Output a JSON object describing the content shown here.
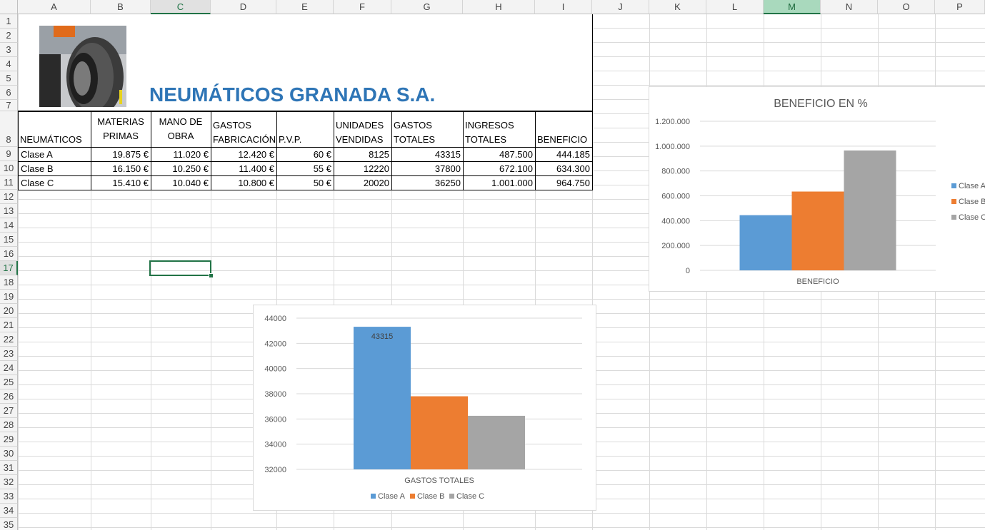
{
  "columns": [
    "A",
    "B",
    "C",
    "D",
    "E",
    "F",
    "G",
    "H",
    "I",
    "J",
    "K",
    "L",
    "M",
    "N",
    "O",
    "P"
  ],
  "rows": [
    "1",
    "2",
    "3",
    "4",
    "5",
    "6",
    "7",
    "8",
    "9",
    "10",
    "11",
    "12",
    "13",
    "14",
    "15",
    "16",
    "17",
    "18",
    "19",
    "20",
    "21",
    "22",
    "23",
    "24",
    "25",
    "26",
    "27",
    "28",
    "29",
    "30",
    "31",
    "32",
    "33",
    "34",
    "35"
  ],
  "title": "NEUMÁTICOS GRANADA S.A.",
  "table": {
    "headers": {
      "a": "NEUMÁTICOS",
      "b1": "MATERIAS",
      "b2": "PRIMAS",
      "c1": "MANO DE",
      "c2": "OBRA",
      "d1": "GASTOS",
      "d2": "FABRICACIÓN",
      "e": "P.V.P.",
      "f1": "UNIDADES",
      "f2": "VENDIDAS",
      "g1": "GASTOS",
      "g2": "TOTALES",
      "h1": "INGRESOS",
      "h2": "TOTALES",
      "i": "BENEFICIO"
    },
    "rows": [
      [
        "Clase A",
        "19.875 €",
        "11.020 €",
        "12.420 €",
        "60 €",
        "8125",
        "43315",
        "487.500",
        "444.185"
      ],
      [
        "Clase B",
        "16.150 €",
        "10.250 €",
        "11.400 €",
        "55 €",
        "12220",
        "37800",
        "672.100",
        "634.300"
      ],
      [
        "Clase C",
        "15.410 €",
        "10.040 €",
        "10.800 €",
        "50 €",
        "20020",
        "36250",
        "1.001.000",
        "964.750"
      ]
    ]
  },
  "colors": {
    "classA": "#5b9bd5",
    "classB": "#ed7d31",
    "classC": "#a5a5a5",
    "title": "#2e75b6",
    "accent": "#217346"
  },
  "chart_data": [
    {
      "type": "bar",
      "title": "BENEFICIO EN %",
      "categories": [
        "BENEFICIO"
      ],
      "xlabel": "BENEFICIO",
      "ylim": [
        0,
        1200000
      ],
      "ytick_labels": [
        "0",
        "200.000",
        "400.000",
        "600.000",
        "800.000",
        "1.000.000",
        "1.200.000"
      ],
      "series": [
        {
          "name": "Clase A",
          "values": [
            444185
          ]
        },
        {
          "name": "Clase B",
          "values": [
            634300
          ]
        },
        {
          "name": "Clase C",
          "values": [
            964750
          ]
        }
      ],
      "legend": "right",
      "grid": true
    },
    {
      "type": "bar",
      "title": "",
      "categories": [
        "GASTOS TOTALES"
      ],
      "xlabel": "GASTOS TOTALES",
      "ylim": [
        32000,
        44000
      ],
      "ytick_labels": [
        "32000",
        "34000",
        "36000",
        "38000",
        "40000",
        "42000",
        "44000"
      ],
      "series": [
        {
          "name": "Clase A",
          "values": [
            43315
          ]
        },
        {
          "name": "Clase B",
          "values": [
            37800
          ]
        },
        {
          "name": "Clase C",
          "values": [
            36250
          ]
        }
      ],
      "data_label": "43315",
      "legend": "bottom",
      "grid": true
    }
  ]
}
